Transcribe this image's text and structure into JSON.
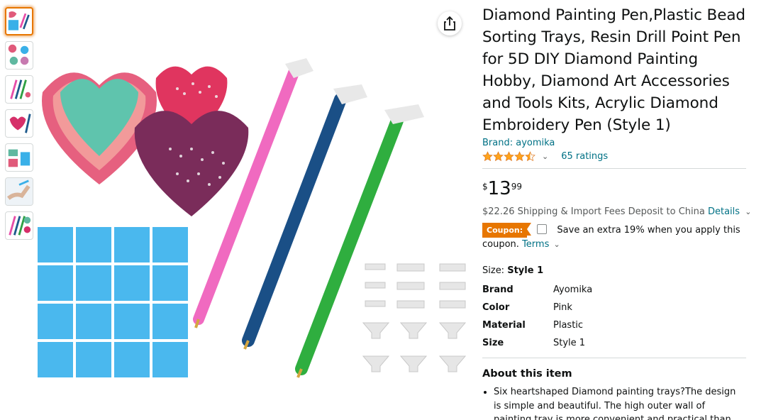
{
  "thumbnails": [
    {
      "name": "thumb-1"
    },
    {
      "name": "thumb-2"
    },
    {
      "name": "thumb-3"
    },
    {
      "name": "thumb-4"
    },
    {
      "name": "thumb-5"
    },
    {
      "name": "thumb-6"
    },
    {
      "name": "thumb-7"
    }
  ],
  "product": {
    "title": "Diamond Painting Pen,Plastic Bead Sorting Trays, Resin Drill Point Pen for 5D DIY Diamond Painting Hobby, Diamond Art Accessories and Tools Kits, Acrylic Diamond Embroidery Pen (Style 1)",
    "brand_link": "Brand: ayomika",
    "rating_value": 4.5,
    "ratings_count": "65 ratings",
    "price": {
      "symbol": "$",
      "whole": "13",
      "fraction": "99"
    },
    "shipping_text": "$22.26 Shipping & Import Fees Deposit to China",
    "shipping_details_link": "Details",
    "coupon_badge": "Coupon:",
    "coupon_text": "Save an extra 19% when you apply this coupon.",
    "coupon_terms_link": "Terms",
    "size_label": "Size:",
    "size_value": "Style 1",
    "specs": [
      {
        "key": "Brand",
        "value": "Ayomika"
      },
      {
        "key": "Color",
        "value": "Pink"
      },
      {
        "key": "Material",
        "value": "Plastic"
      },
      {
        "key": "Size",
        "value": "Style 1"
      }
    ],
    "about_heading": "About this item",
    "bullets": [
      "Six heartshaped Diamond painting trays?The design is simple and beautiful. The high outer wall of painting tray is more convenient and practical than the ordinary tray."
    ]
  },
  "colors": {
    "link": "#007185",
    "coupon": "#e77600",
    "star": "#ffa41c",
    "text": "#0f1111"
  },
  "icons": {
    "share": "share-icon",
    "star": "star-icon",
    "chevron": "chevron-down-icon"
  }
}
